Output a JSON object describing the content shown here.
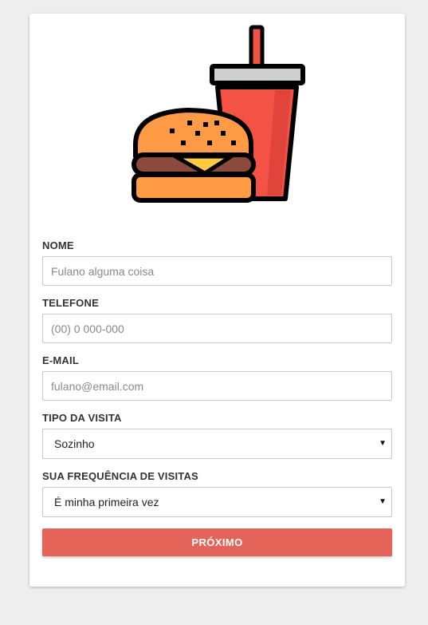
{
  "logo": {
    "icon": "burger-and-soda-icon"
  },
  "form": {
    "name": {
      "label": "NOME",
      "placeholder": "Fulano alguma coisa",
      "value": ""
    },
    "phone": {
      "label": "TELEFONE",
      "placeholder": "(00) 0 000-000",
      "value": ""
    },
    "email": {
      "label": "E-MAIL",
      "placeholder": "fulano@email.com",
      "value": ""
    },
    "visit_type": {
      "label": "TIPO DA VISITA",
      "selected": "Sozinho",
      "arrow_icon": "caret-down-icon"
    },
    "frequency": {
      "label": "SUA FREQUÊNCIA DE VISITAS",
      "selected": "É minha primeira vez",
      "arrow_icon": "caret-down-icon"
    },
    "submit_label": "PRÓXIMO"
  },
  "colors": {
    "accent": "#e5645a",
    "bun": "#ff9a45",
    "patty": "#8b4a3c",
    "cheese": "#ffc940",
    "cup": "#f45245",
    "lid": "#cfcfcf",
    "outline": "#000000"
  }
}
